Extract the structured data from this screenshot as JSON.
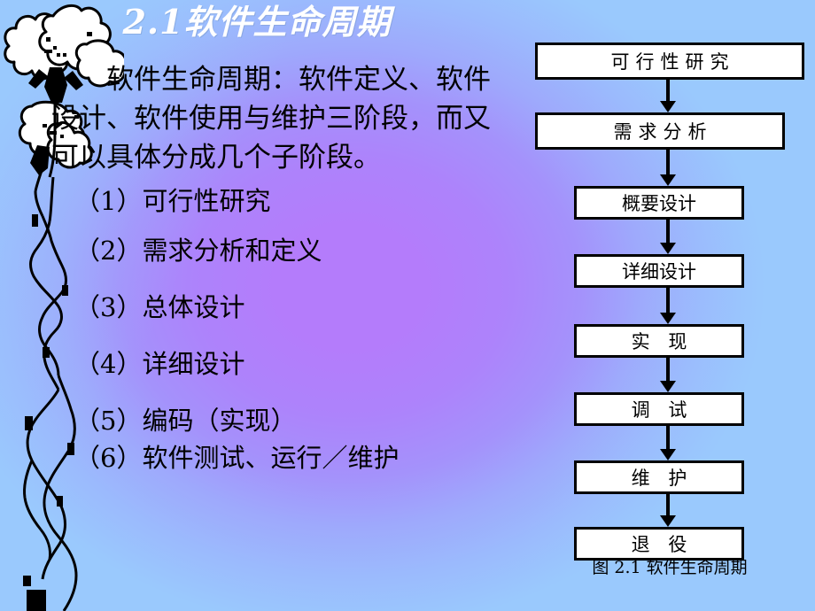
{
  "slide": {
    "title": "2.1软件生命周期",
    "background": {
      "center_color": "#b47cfb",
      "edge_color": "#9ac9fd"
    },
    "title_color": "#ffffff",
    "text_color": "#000000"
  },
  "content": {
    "paragraph": "软件生命周期：软件定义、软件设计、软件使用与维护三阶段，而又可以具体分成几个子阶段。",
    "list": [
      "（1）可行性研究",
      "（2）需求分析和定义",
      "（3）总体设计",
      "（4）详细设计",
      "（5）编码（实现）",
      "（6）软件测试、运行／维护"
    ]
  },
  "flowchart": {
    "caption": "图 2.1  软件生命周期",
    "nodes": [
      {
        "label": "可行性研究",
        "spaced": true
      },
      {
        "label": "需求分析",
        "spaced": true
      },
      {
        "label": "概要设计",
        "spaced": false
      },
      {
        "label": "详细设计",
        "spaced": false
      },
      {
        "label": "实 现",
        "spaced": true
      },
      {
        "label": "调 试",
        "spaced": true
      },
      {
        "label": "维 护",
        "spaced": true
      },
      {
        "label": "退 役",
        "spaced": true
      }
    ]
  },
  "decoration": {
    "flower_label": "white-flower-clipart"
  }
}
